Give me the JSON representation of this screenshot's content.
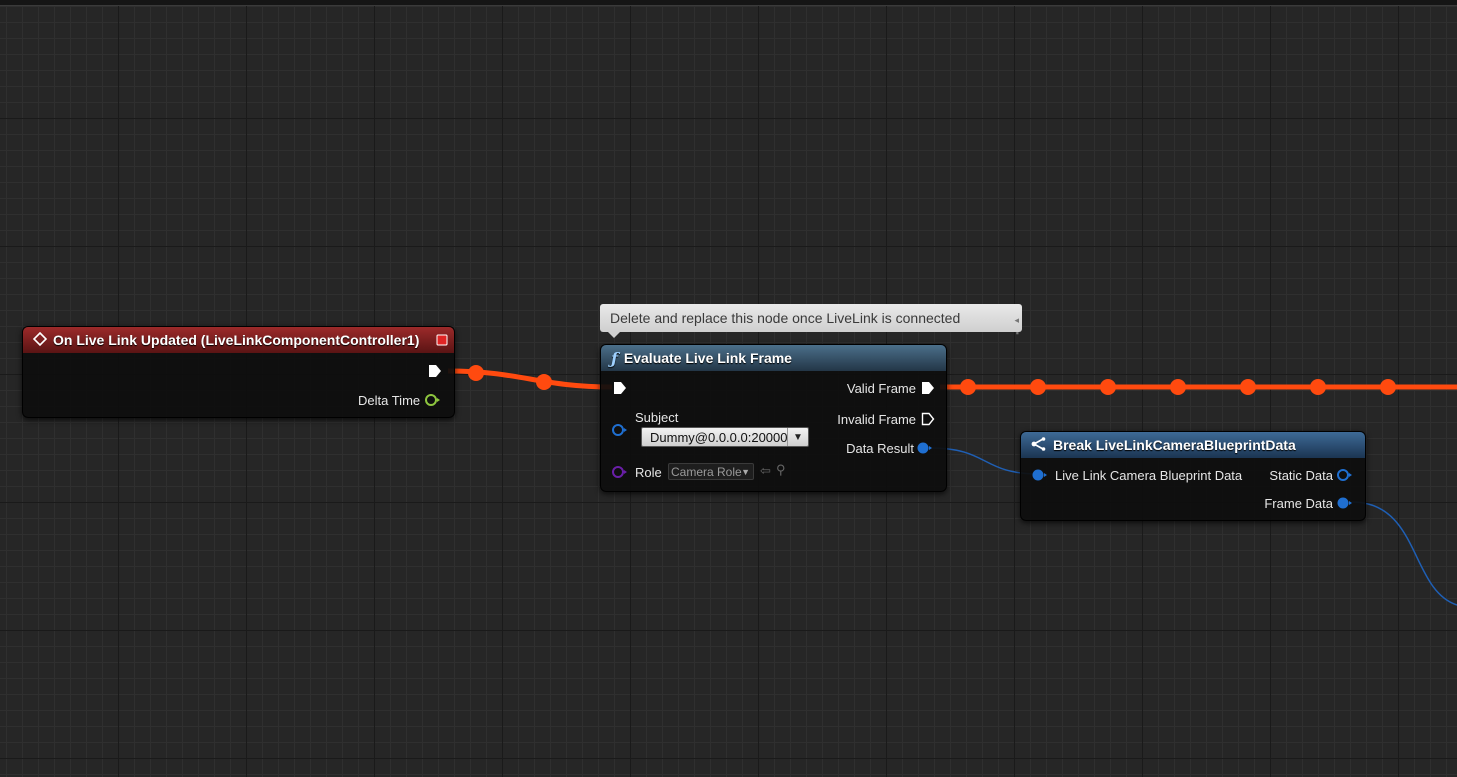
{
  "colors": {
    "exec_wire": "#ff4a0f",
    "struct_wire": "#1f5fb4",
    "event_header": "#7a1e1e",
    "function_header": "#3b5a72",
    "break_header": "#2a4d74",
    "float_pin": "#8ec63f",
    "struct_pin": "#1f6fd1",
    "role_pin": "#6a1fa8"
  },
  "event_node": {
    "title": "On Live Link Updated (LiveLinkComponentController1)",
    "icon": "event-diamond-icon",
    "delta_time_label": "Delta Time"
  },
  "comment_tooltip": {
    "text": "Delete and replace this node once LiveLink is connected"
  },
  "evaluate_node": {
    "title": "Evaluate Live Link Frame",
    "icon": "function-f-icon",
    "valid_frame_label": "Valid Frame",
    "invalid_frame_label": "Invalid Frame",
    "subject_label": "Subject",
    "subject_value": "Dummy@0.0.0.0:20000",
    "data_result_label": "Data Result",
    "role_label": "Role",
    "role_value": "Camera Role"
  },
  "break_node": {
    "title": "Break LiveLinkCameraBlueprintData",
    "icon": "break-struct-icon",
    "input_label": "Live Link Camera Blueprint Data",
    "static_data_label": "Static Data",
    "frame_data_label": "Frame Data"
  }
}
